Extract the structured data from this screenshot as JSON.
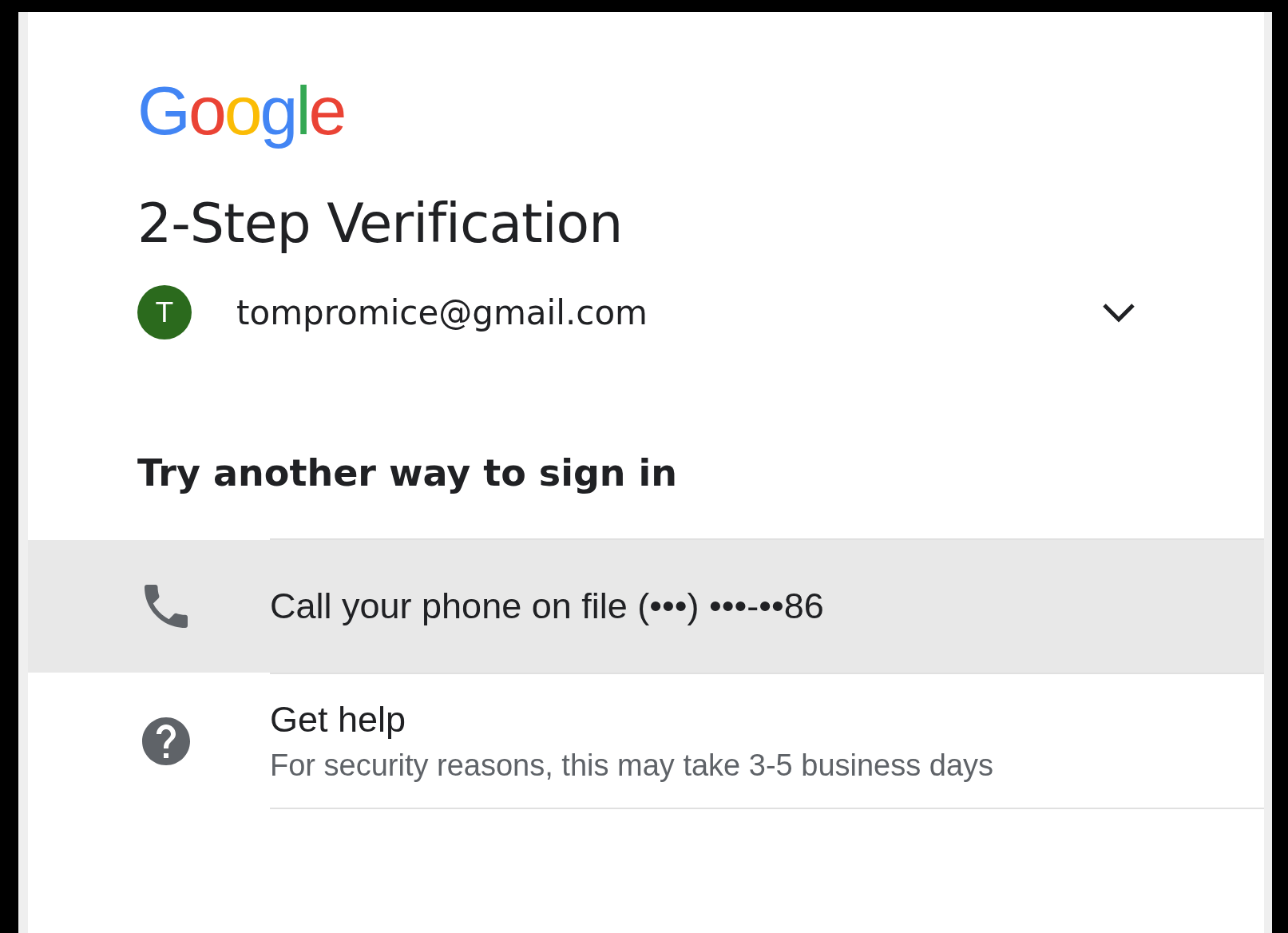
{
  "logo": "Google",
  "title": "2-Step Verification",
  "account": {
    "initial": "T",
    "email": "tompromice@gmail.com"
  },
  "heading": "Try another way to sign in",
  "options": [
    {
      "kind": "phone",
      "label": "Call your phone on file (•••) •••-••86",
      "selected": true
    },
    {
      "kind": "help",
      "label": "Get help",
      "detail": "For security reasons, this may take 3-5 business days",
      "selected": false
    }
  ]
}
